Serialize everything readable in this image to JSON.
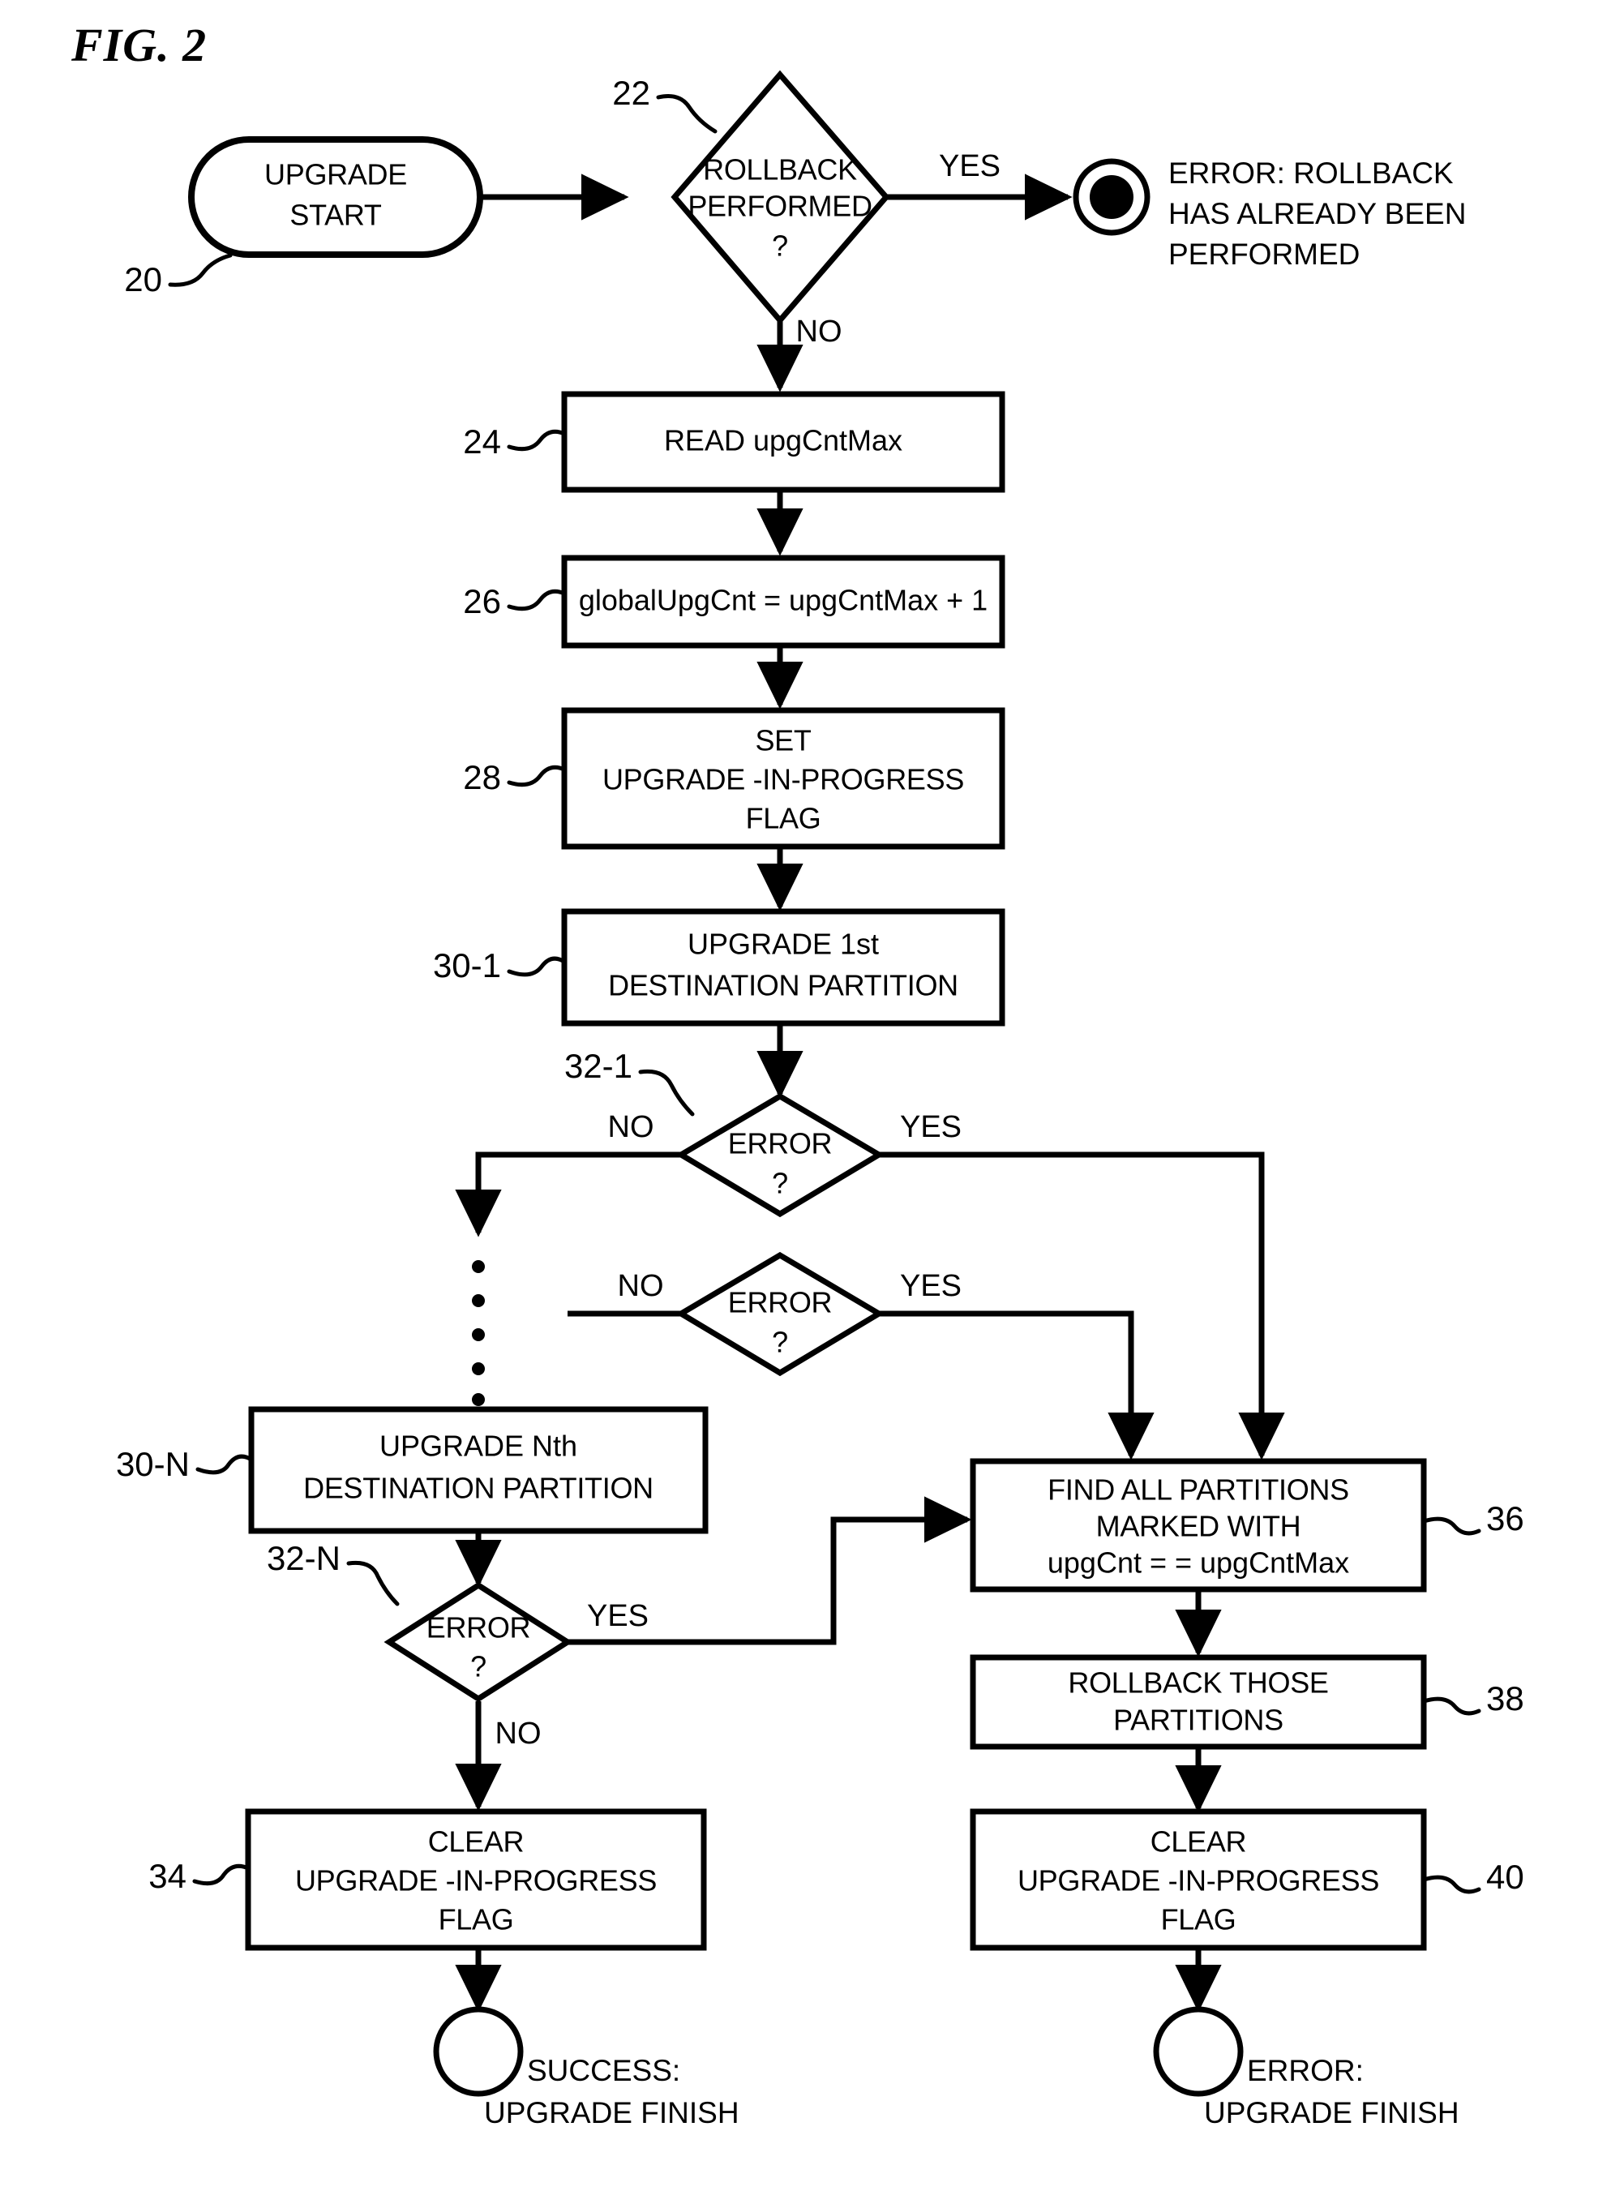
{
  "figure": {
    "title": "FIG. 2",
    "type": "patent-flowchart"
  },
  "nodes": {
    "start": {
      "ref": "20",
      "shape": "rounded-terminal",
      "lines": [
        "UPGRADE",
        "START"
      ]
    },
    "rollback_check": {
      "ref": "22",
      "shape": "decision",
      "lines": [
        "ROLLBACK",
        "PERFORMED",
        "?"
      ],
      "yes_label": "YES",
      "no_label": "NO"
    },
    "rollback_error_terminal": {
      "shape": "filled-circle",
      "annotation_lines": [
        "ERROR: ROLLBACK",
        "HAS ALREADY BEEN",
        "PERFORMED"
      ]
    },
    "read_max": {
      "ref": "24",
      "shape": "process",
      "lines": [
        "READ upgCntMax"
      ]
    },
    "set_global": {
      "ref": "26",
      "shape": "process",
      "lines": [
        "globalUpgCnt = upgCntMax + 1"
      ]
    },
    "set_flag": {
      "ref": "28",
      "shape": "process",
      "lines": [
        "SET",
        "UPGRADE -IN-PROGRESS",
        "FLAG"
      ]
    },
    "upgrade_first": {
      "ref": "30-1",
      "shape": "process",
      "lines": [
        "UPGRADE 1st",
        "DESTINATION PARTITION"
      ]
    },
    "error_check_first": {
      "ref": "32-1",
      "shape": "decision",
      "lines": [
        "ERROR",
        "?"
      ],
      "no_label": "NO",
      "yes_label": "YES"
    },
    "error_check_mid": {
      "ref": "",
      "shape": "decision",
      "lines": [
        "ERROR",
        "?"
      ],
      "no_label": "NO",
      "yes_label": "YES"
    },
    "upgrade_nth": {
      "ref": "30-N",
      "shape": "process",
      "lines": [
        "UPGRADE Nth",
        "DESTINATION PARTITION"
      ]
    },
    "error_check_nth": {
      "ref": "32-N",
      "shape": "decision",
      "lines": [
        "ERROR",
        "?"
      ],
      "yes_label": "YES",
      "no_label": "NO"
    },
    "clear_flag_success": {
      "ref": "34",
      "shape": "process",
      "lines": [
        "CLEAR",
        "UPGRADE -IN-PROGRESS",
        "FLAG"
      ]
    },
    "find_partitions": {
      "ref": "36",
      "shape": "process",
      "lines": [
        "FIND ALL PARTITIONS",
        "MARKED WITH",
        "upgCnt = = upgCntMax"
      ]
    },
    "rollback_partitions": {
      "ref": "38",
      "shape": "process",
      "lines": [
        "ROLLBACK THOSE",
        "PARTITIONS"
      ]
    },
    "clear_flag_error": {
      "ref": "40",
      "shape": "process",
      "lines": [
        "CLEAR",
        "UPGRADE -IN-PROGRESS",
        "FLAG"
      ]
    },
    "success_terminal": {
      "shape": "circle",
      "annotation_lines": [
        "SUCCESS:",
        "UPGRADE FINISH"
      ]
    },
    "error_terminal": {
      "shape": "circle",
      "annotation_lines": [
        "ERROR:",
        "UPGRADE FINISH"
      ]
    }
  },
  "ellipsis": {
    "symbol": "vertical-dots",
    "count": 5
  },
  "colors": {
    "ink": "#000000",
    "paper": "#ffffff"
  }
}
